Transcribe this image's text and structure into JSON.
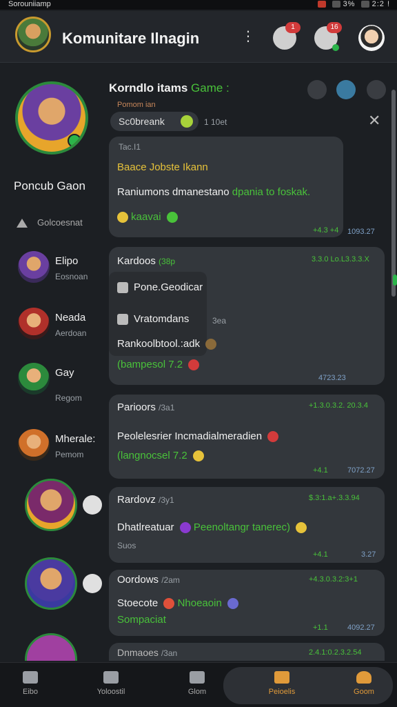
{
  "status_bar": {
    "app": "Sorouniiamp",
    "time": "2:2 !",
    "battery": "3%"
  },
  "header": {
    "title": "Komunitare Ilnagin",
    "badge1": "1",
    "badge2": "16"
  },
  "sidebar": {
    "name": "Poncub Gaon",
    "setting": "Golcoesnat",
    "contacts": [
      {
        "name": "Elipo",
        "sub": "Eosnoan"
      },
      {
        "name": "Neada",
        "sub": "Aerdoan"
      },
      {
        "name": "Gay",
        "sub": "Regom"
      },
      {
        "name": "Mherale:",
        "sub": "Pemom"
      }
    ]
  },
  "chat": {
    "title_part": "Korndlo itams",
    "title_game": "Game :",
    "subtitle": "Pomom ian",
    "pill": "Sc0breank",
    "pill_meta": "1 10et",
    "card1": {
      "label": "Tac.I1",
      "line1": "Baace Jobste Ikann",
      "line2_a": "Raniumons dmanestano",
      "line2_b": "dpania to foskak.",
      "line3": "kaavai",
      "ticks": "+4.3 +4",
      "time": "1093.27"
    },
    "card2": {
      "name": "Kardoos",
      "age": "(38p",
      "time_top": "3.3.0 Lo.L3.3.3.X",
      "item1": "Pone.Geodicar",
      "item2": "Vratomdans",
      "item2_meta": "3ea",
      "line3": "Rankoolbtool.:adk",
      "line4": "(bampesol 7.2",
      "time": "4723.23"
    },
    "card3": {
      "name": "Parioors",
      "age": "/3a1",
      "time_top": "+1.3.0.3.2. 20.3.4",
      "line1": "Peolelesrier Incmadialmeradien",
      "line2": "(langnocsel 7.2",
      "ticks": "+4.1",
      "time": "7072.27"
    },
    "card4": {
      "name": "Rardovz",
      "age": "/3y1",
      "time_top": "$.3:1.a+.3.3.94",
      "line1_a": "Dhatlreatuar",
      "line1_b": "Peenoltangr tanerec)",
      "line2": "Suos",
      "ticks": "+4.1 ",
      "time": "3.27"
    },
    "card5": {
      "name": "Oordows",
      "age": "/2am",
      "time_top": "+4.3.0.3.2:3+1",
      "line1_a": "Stoecote",
      "line1_b": "Nhoeaoin",
      "line2": "Sompaciat",
      "ticks": "+1.1",
      "time": "4092.27"
    },
    "card6": {
      "name": "Dnmaoes",
      "age": "/3an",
      "time_top": "2.4.1:0.2.3.2.54"
    }
  },
  "nav": {
    "items": [
      "Eibo",
      "Yoloostil",
      "Glom",
      "Peioelis",
      "Goom"
    ]
  },
  "colors": {
    "accent_green": "#49c23a",
    "accent_orange": "#e09a3a",
    "background": "#1c1f23",
    "card": "#33373c"
  }
}
